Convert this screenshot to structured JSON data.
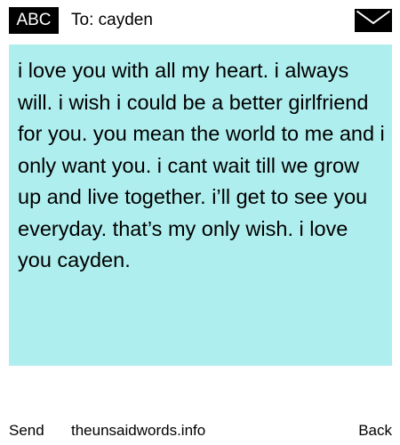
{
  "header": {
    "badge_label": "ABC",
    "to_line": "To: cayden",
    "icon": "envelope-icon"
  },
  "message": {
    "text": "i love you with all my heart. i always will. i wish i could be a better girlfriend for you. you mean the world to me and i only want you.  i cant wait till we grow up and live together. i’ll get to see you everyday. that’s my only wish. i love you cayden.",
    "background": "#afeeee"
  },
  "footer": {
    "send_label": "Send",
    "site_label": "theunsaidwords.info",
    "back_label": "Back"
  },
  "colors": {
    "badge_background": "#000000",
    "badge_text": "#ffffff",
    "page_background": "#ffffff"
  }
}
